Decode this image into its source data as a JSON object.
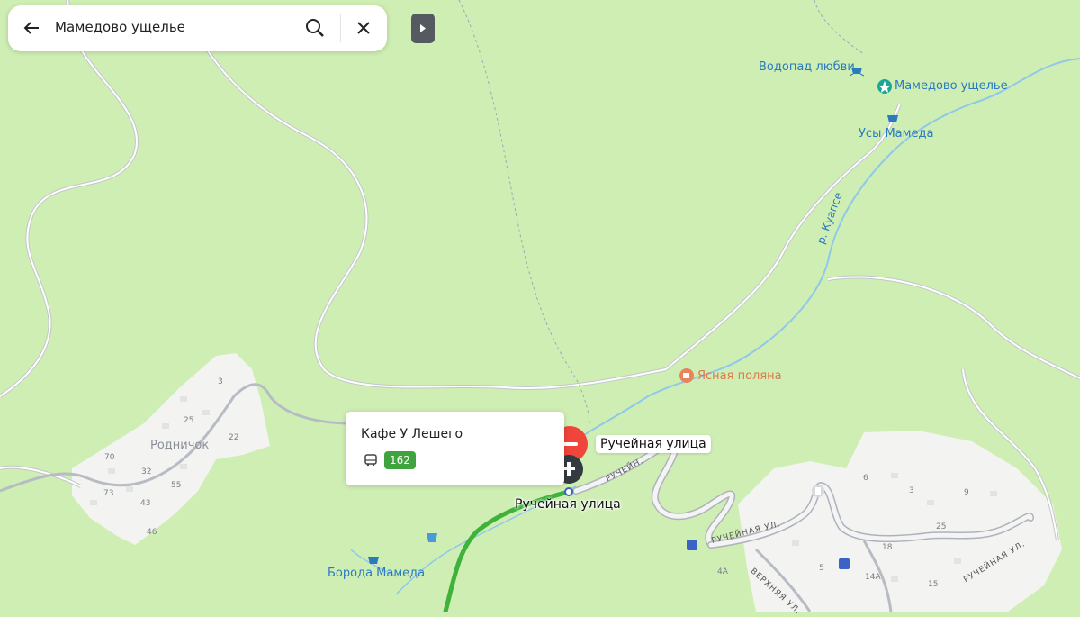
{
  "search": {
    "query": "Мамедово ущелье"
  },
  "map": {
    "pois": {
      "waterfall_love": "Водопад любви",
      "gorge": "Мамедово ущелье",
      "usy": "Усы Мамеда",
      "yasnaya": "Ясная поляна",
      "boroda": "Борода Мамеда"
    },
    "river": "р. Куапсе",
    "village": "Родничок",
    "street_tag": "Ручейная улица",
    "street_stop": "Ручейная улица",
    "roads": {
      "r1": "РУЧЕЙН.",
      "r2": "РУЧЕЙНАЯ УЛ.",
      "r3": "ВЕРХНЯЯ УЛ.",
      "r4": "РУЧЕЙНАЯ УЛ."
    },
    "house_numbers_left": [
      "3",
      "25",
      "22",
      "70",
      "32",
      "55",
      "73",
      "43",
      "46"
    ],
    "house_numbers_right": [
      "6",
      "3",
      "9",
      "25",
      "18",
      "5",
      "14А",
      "15",
      "4А"
    ]
  },
  "popup": {
    "title": "Кафе У Лешего",
    "route": "162"
  },
  "colors": {
    "land": "#cfeeb4",
    "settlement": "#f3f3f1",
    "road": "#b7bcc4",
    "water": "#59b6e6",
    "route": "#3fb23a",
    "marker": "#f0453a"
  }
}
